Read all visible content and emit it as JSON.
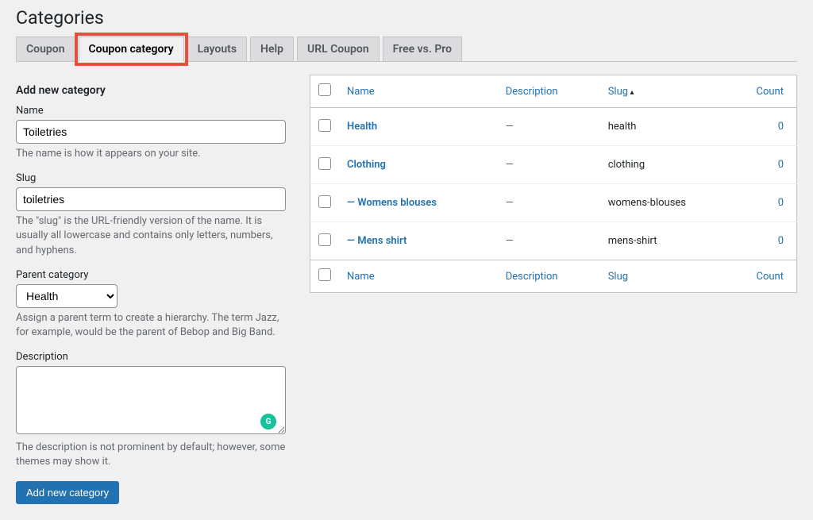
{
  "page_title": "Categories",
  "tabs": {
    "coupon": "Coupon",
    "coupon_category": "Coupon category",
    "layouts": "Layouts",
    "help": "Help",
    "url_coupon": "URL Coupon",
    "free_vs_pro": "Free vs. Pro"
  },
  "form": {
    "heading": "Add new category",
    "name_label": "Name",
    "name_value": "Toiletries",
    "name_help": "The name is how it appears on your site.",
    "slug_label": "Slug",
    "slug_value": "toiletries",
    "slug_help": "The \"slug\" is the URL-friendly version of the name. It is usually all lowercase and contains only letters, numbers, and hyphens.",
    "parent_label": "Parent category",
    "parent_value": "Health",
    "parent_help": "Assign a parent term to create a hierarchy. The term Jazz, for example, would be the parent of Bebop and Big Band.",
    "desc_label": "Description",
    "desc_value": "",
    "desc_help": "The description is not prominent by default; however, some themes may show it.",
    "submit_label": "Add new category"
  },
  "table": {
    "headers": {
      "name": "Name",
      "description": "Description",
      "slug": "Slug",
      "count": "Count"
    },
    "rows": [
      {
        "name": "Health",
        "description": "—",
        "slug": "health",
        "count": "0"
      },
      {
        "name": "Clothing",
        "description": "—",
        "slug": "clothing",
        "count": "0"
      },
      {
        "name": "— Womens blouses",
        "description": "—",
        "slug": "womens-blouses",
        "count": "0"
      },
      {
        "name": "— Mens shirt",
        "description": "—",
        "slug": "mens-shirt",
        "count": "0"
      }
    ]
  }
}
